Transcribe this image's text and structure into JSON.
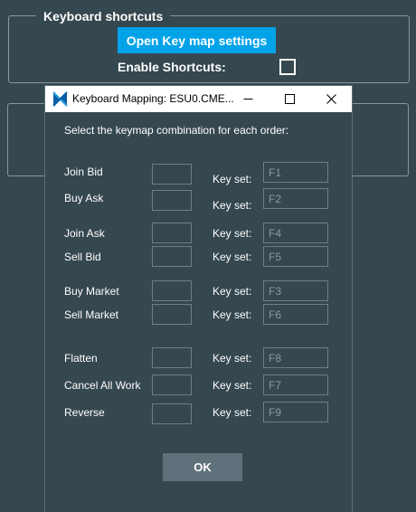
{
  "settings": {
    "keyboard_shortcuts_title": "Keyboard shortcuts",
    "open_keymap_button": "Open Key map settings",
    "enable_shortcuts_label": "Enable Shortcuts:",
    "enable_shortcuts_checked": false
  },
  "dialog": {
    "title": "Keyboard Mapping: ESU0.CME...",
    "intro": "Select the keymap combination for each order:",
    "keyset_label": "Key set:",
    "rows": [
      {
        "label": "Join Bid",
        "keyset": "F1"
      },
      {
        "label": "Buy Ask",
        "keyset": "F2"
      },
      {
        "label": "Join Ask",
        "keyset": "F4"
      },
      {
        "label": "Sell Bid",
        "keyset": "F5"
      },
      {
        "label": "Buy Market",
        "keyset": "F3"
      },
      {
        "label": "Sell Market",
        "keyset": "F6"
      },
      {
        "label": "Flatten",
        "keyset": "F8"
      },
      {
        "label": "Cancel All Work",
        "keyset": "F7"
      },
      {
        "label": "Reverse",
        "keyset": "F9"
      }
    ],
    "ok_button": "OK"
  },
  "colors": {
    "background": "#35474f",
    "accent": "#00a2e8",
    "ok_button": "#5f727b"
  }
}
